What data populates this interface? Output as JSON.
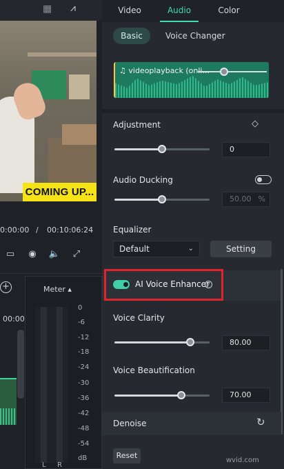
{
  "tabs": [
    {
      "label": "Video"
    },
    {
      "label": "Audio"
    },
    {
      "label": "Color"
    }
  ],
  "subtabs": {
    "basic": "Basic",
    "voice_changer": "Voice Changer"
  },
  "clip": {
    "name": "videoplayback (onli..."
  },
  "preview": {
    "overlay_text": "COMING UP..."
  },
  "player": {
    "current_time": "0:00:00",
    "separator": "/",
    "total_time": "00:10:06:24"
  },
  "timeline": {
    "time": "00:00"
  },
  "meter": {
    "title": "Meter",
    "title_arrow": "▴",
    "db_labels": [
      "0",
      "-6",
      "-12",
      "-18",
      "-24",
      "-30",
      "-36",
      "-42",
      "-48",
      "-54",
      "dB"
    ],
    "left": "L",
    "right": "R"
  },
  "adjustment": {
    "label": "Adjustment",
    "value": "0",
    "level": 0.5
  },
  "audio_ducking": {
    "label": "Audio Ducking",
    "value": "50.00",
    "unit": "%",
    "level": 0.5
  },
  "equalizer": {
    "label": "Equalizer",
    "selected": "Default",
    "setting_button": "Setting"
  },
  "ai_voice_enhancer": {
    "label": "AI Voice Enhancer",
    "help": "?",
    "enabled": true
  },
  "voice_clarity": {
    "label": "Voice Clarity",
    "value": "80.00",
    "level": 0.8
  },
  "voice_beautification": {
    "label": "Voice Beautification",
    "value": "70.00",
    "level": 0.7
  },
  "denoise": {
    "label": "Denoise"
  },
  "reset_button": "Reset",
  "watermark": "wvid.com",
  "colors": {
    "accent": "#43dbb0",
    "highlight_border": "#e0242b",
    "overlay_yellow": "#f6e316"
  }
}
